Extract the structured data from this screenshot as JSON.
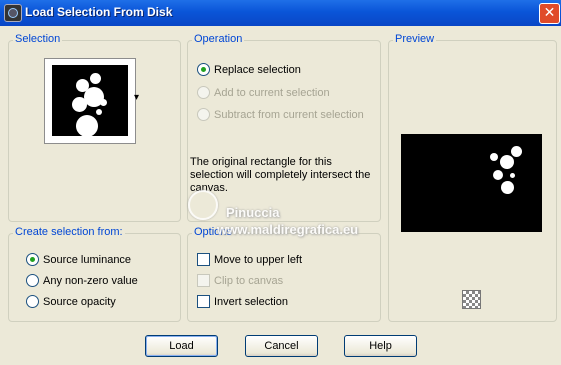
{
  "window": {
    "title": "Load Selection From Disk",
    "close_glyph": "✕"
  },
  "selection": {
    "label": "Selection",
    "dropdown_glyph": "▾"
  },
  "operation": {
    "label": "Operation",
    "options": [
      {
        "label": "Replace selection",
        "checked": true,
        "enabled": true
      },
      {
        "label": "Add to current selection",
        "checked": false,
        "enabled": false
      },
      {
        "label": "Subtract from current selection",
        "checked": false,
        "enabled": false
      }
    ],
    "info_text": "The original rectangle for this selection will completely intersect the canvas."
  },
  "preview": {
    "label": "Preview"
  },
  "create_from": {
    "label": "Create selection from:",
    "options": [
      {
        "label": "Source luminance",
        "checked": true
      },
      {
        "label": "Any non-zero value",
        "checked": false
      },
      {
        "label": "Source opacity",
        "checked": false
      }
    ]
  },
  "options": {
    "label": "Options",
    "items": [
      {
        "label": "Move to upper left",
        "checked": false,
        "enabled": true
      },
      {
        "label": "Clip to canvas",
        "checked": false,
        "enabled": false
      },
      {
        "label": "Invert selection",
        "checked": false,
        "enabled": true
      }
    ]
  },
  "buttons": {
    "load": "Load",
    "cancel": "Cancel",
    "help": "Help"
  },
  "watermark": {
    "name": "Pinuccia",
    "site": "www.maldiregrafica.eu"
  },
  "colors": {
    "accent_label": "#0046d5",
    "titlebar": "#0a55d8",
    "radio_check": "#21a121"
  }
}
